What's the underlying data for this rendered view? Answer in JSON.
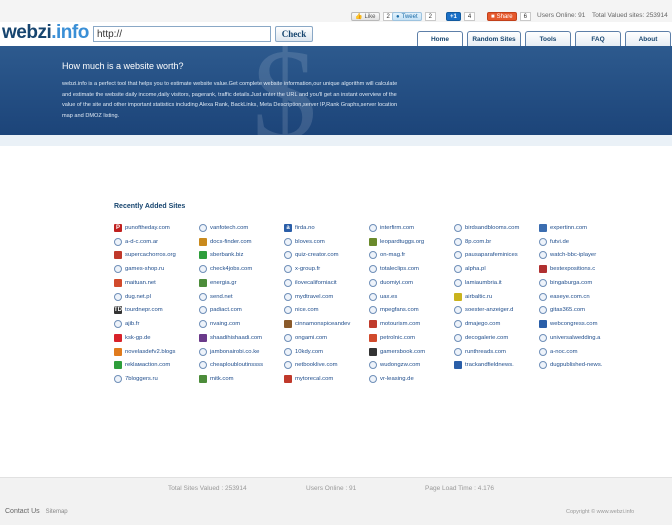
{
  "topbar": {
    "like_label": "Like",
    "like_count": "2",
    "tweet_label": "Tweet",
    "tweet_count": "2",
    "plus_label": "+1",
    "plus_count": "4",
    "share_label": "Share",
    "share_count": "6",
    "users_online": "Users Online: 91",
    "total_valued": "Total Valued sites: 253914"
  },
  "header": {
    "logo_main": "webzi",
    "logo_suffix": ".info",
    "url_value": "http://",
    "check_label": "Check",
    "nav": [
      "Home",
      "Random Sites",
      "Tools",
      "FAQ",
      "About"
    ]
  },
  "banner": {
    "title": "How much is a website worth?",
    "description": "webzi.info is a perfect tool that helps you to estimate website value.Get complete website information,our unique algorithm will calculate and estimate the website daily income,daily visitors, pagerank, traffic details.Just enter the URL and you'll get an instant overview of the value of the site and other important statistics including Alexa Rank, BackLinks, Meta Description,server IP,Rank Graphs,server location map and DMOZ listing.",
    "symbol": "$"
  },
  "recent": {
    "title": "Recently Added Sites",
    "sites": [
      {
        "name": "punoftheday.com",
        "icon": "P",
        "color": "#c0201e"
      },
      {
        "name": "vanfotech.com",
        "icon": "",
        "color": "ring"
      },
      {
        "name": "firda.no",
        "icon": "a",
        "color": "#2a5ea8"
      },
      {
        "name": "interfirm.com",
        "icon": "",
        "color": "ring"
      },
      {
        "name": "birdsandblooms.com",
        "icon": "",
        "color": "ring"
      },
      {
        "name": "expertinn.com",
        "icon": "",
        "color": "#3b6db0"
      },
      {
        "name": "a-d-c.com.ar",
        "icon": "",
        "color": "ring"
      },
      {
        "name": "docs-finder.com",
        "icon": "",
        "color": "#c98a1d"
      },
      {
        "name": "bloves.com",
        "icon": "",
        "color": "ring"
      },
      {
        "name": "leopardtuggs.org",
        "icon": "",
        "color": "#6a8a2b"
      },
      {
        "name": "8p.com.br",
        "icon": "",
        "color": "ring"
      },
      {
        "name": "futvi.de",
        "icon": "",
        "color": "ring"
      },
      {
        "name": "supercachorros.org",
        "icon": "",
        "color": "#c0392b"
      },
      {
        "name": "sberbank.biz",
        "icon": "",
        "color": "#2e9e3b"
      },
      {
        "name": "quiz-creator.com",
        "icon": "",
        "color": "ring"
      },
      {
        "name": "on-mag.fr",
        "icon": "",
        "color": "ring"
      },
      {
        "name": "pausaparafeminices",
        "icon": "",
        "color": "ring"
      },
      {
        "name": "watch-bbc-iplayer",
        "icon": "",
        "color": "ring"
      },
      {
        "name": "games-shop.ru",
        "icon": "",
        "color": "ring"
      },
      {
        "name": "check4jobs.com",
        "icon": "",
        "color": "ring"
      },
      {
        "name": "x-group.fr",
        "icon": "",
        "color": "ring"
      },
      {
        "name": "totaleclips.com",
        "icon": "",
        "color": "ring"
      },
      {
        "name": "alpha.pl",
        "icon": "",
        "color": "ring"
      },
      {
        "name": "bestexpositions.c",
        "icon": "",
        "color": "#b03030"
      },
      {
        "name": "maituan.net",
        "icon": "",
        "color": "#d14a2c"
      },
      {
        "name": "energia.gr",
        "icon": "",
        "color": "#4c8c3a"
      },
      {
        "name": "ilovecaliforniacit",
        "icon": "",
        "color": "ring"
      },
      {
        "name": "duomiyi.com",
        "icon": "",
        "color": "ring"
      },
      {
        "name": "lamiaumbria.it",
        "icon": "",
        "color": "ring"
      },
      {
        "name": "bingaburga.com",
        "icon": "",
        "color": "ring"
      },
      {
        "name": "dug.net.pl",
        "icon": "",
        "color": "ring"
      },
      {
        "name": "send.net",
        "icon": "",
        "color": "ring"
      },
      {
        "name": "mydtravel.com",
        "icon": "",
        "color": "ring"
      },
      {
        "name": "uax.es",
        "icon": "",
        "color": "ring"
      },
      {
        "name": "airbaltic.ru",
        "icon": "",
        "color": "#c9b31d"
      },
      {
        "name": "easeye.com.cn",
        "icon": "",
        "color": "ring"
      },
      {
        "name": "tourdnepr.com",
        "icon": "TD",
        "color": "#333333"
      },
      {
        "name": "padiact.com",
        "icon": "",
        "color": "ring"
      },
      {
        "name": "nice.com",
        "icon": "",
        "color": "ring"
      },
      {
        "name": "mpegfans.com",
        "icon": "",
        "color": "ring"
      },
      {
        "name": "soester-anzeiger.d",
        "icon": "",
        "color": "ring"
      },
      {
        "name": "gitas365.com",
        "icon": "",
        "color": "ring"
      },
      {
        "name": "ajib.fr",
        "icon": "",
        "color": "ring"
      },
      {
        "name": "nvaing.com",
        "icon": "",
        "color": "ring"
      },
      {
        "name": "cinnamonspiceandev",
        "icon": "",
        "color": "#8a5a2b"
      },
      {
        "name": "motourism.com",
        "icon": "",
        "color": "#c03a2b"
      },
      {
        "name": "dmajego.com",
        "icon": "",
        "color": "ring"
      },
      {
        "name": "webcongress.com",
        "icon": "",
        "color": "#2a5ea8"
      },
      {
        "name": "ksk-gp.de",
        "icon": "",
        "color": "#d8222a"
      },
      {
        "name": "shaadihishaadi.com",
        "icon": "",
        "color": "#6a3a8a"
      },
      {
        "name": "ongami.com",
        "icon": "",
        "color": "ring"
      },
      {
        "name": "petrolnic.com",
        "icon": "",
        "color": "#d14a2c"
      },
      {
        "name": "decogalerie.com",
        "icon": "",
        "color": "ring"
      },
      {
        "name": "universalwedding.a",
        "icon": "",
        "color": "ring"
      },
      {
        "name": "novelasdefv2.blogs",
        "icon": "",
        "color": "#e07b1d"
      },
      {
        "name": "jambonairobi.co.ke",
        "icon": "",
        "color": "ring"
      },
      {
        "name": "10kdy.com",
        "icon": "",
        "color": "ring"
      },
      {
        "name": "gamersbook.com",
        "icon": "",
        "color": "#333333"
      },
      {
        "name": "runthreads.com",
        "icon": "",
        "color": "ring"
      },
      {
        "name": "a-noc.com",
        "icon": "",
        "color": "ring"
      },
      {
        "name": "reklaмaction.com",
        "icon": "",
        "color": "#2e9e3b"
      },
      {
        "name": "cheaploubloutinssss",
        "icon": "",
        "color": "ring"
      },
      {
        "name": "netbooklive.com",
        "icon": "",
        "color": "ring"
      },
      {
        "name": "wudongzw.com",
        "icon": "",
        "color": "ring"
      },
      {
        "name": "trackandfieldnews.",
        "icon": "",
        "color": "#2a5ea8"
      },
      {
        "name": "dugpublished-news.",
        "icon": "",
        "color": "ring"
      },
      {
        "name": "7bloggers.ru",
        "icon": "",
        "color": "ring"
      },
      {
        "name": "mitk.com",
        "icon": "",
        "color": "#4c8c3a"
      },
      {
        "name": "mytorecal.com",
        "icon": "",
        "color": "#c0392b"
      },
      {
        "name": "vr-leasing.de",
        "icon": "",
        "color": "ring"
      }
    ]
  },
  "footer": {
    "total_sites": "Total Sites Valued : 253914",
    "users_online": "Users Online : 91",
    "load_time": "Page Load Time : 4.176",
    "contact": "Contact Us",
    "sitemap": "Sitemap",
    "copyright": "Copyright © www.webzi.info"
  }
}
